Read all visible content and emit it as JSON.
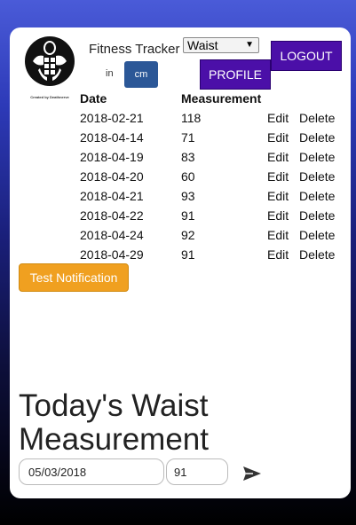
{
  "app": {
    "title": "Fitness Tracker",
    "logo_caption": "Created by Deathnerve"
  },
  "measurement_select": {
    "selected": "Waist"
  },
  "buttons": {
    "logout": "LOGOUT",
    "profile": "PROFILE",
    "test_notification": "Test Notification"
  },
  "units": {
    "in": "in",
    "cm": "cm",
    "active": "cm"
  },
  "table": {
    "headers": {
      "date": "Date",
      "measurement": "Measurement"
    },
    "edit_label": "Edit",
    "delete_label": "Delete",
    "rows": [
      {
        "date": "2018-02-21",
        "value": "118"
      },
      {
        "date": "2018-04-14",
        "value": "71"
      },
      {
        "date": "2018-04-19",
        "value": "83"
      },
      {
        "date": "2018-04-20",
        "value": "60"
      },
      {
        "date": "2018-04-21",
        "value": "93"
      },
      {
        "date": "2018-04-22",
        "value": "91"
      },
      {
        "date": "2018-04-24",
        "value": "92"
      },
      {
        "date": "2018-04-29",
        "value": "91"
      }
    ]
  },
  "entry": {
    "heading": "Today's Waist Measurement",
    "date_value": "05/03/2018",
    "measurement_value": "91"
  },
  "icons": {
    "send": "send-icon",
    "chevron": "chevron-down-icon"
  },
  "colors": {
    "primary_purple": "#4b0fa8",
    "unit_active": "#2b5797",
    "notify_orange": "#f0a020"
  }
}
